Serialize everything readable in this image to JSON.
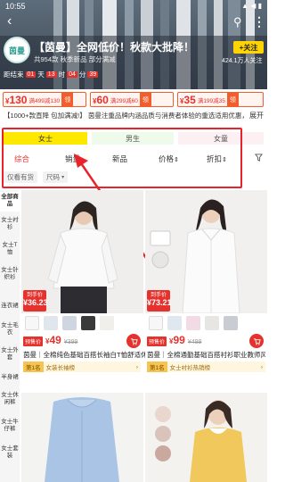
{
  "status": {
    "time": "10:55",
    "sys": "▲ ◀ ▮"
  },
  "nav": {
    "back": "‹",
    "search": "⚲",
    "more": "⋮"
  },
  "shop": {
    "logo": "茵曼",
    "name": "【茵曼】全网低价！秋款大批降！",
    "sub": "共954款  秋季新品  部分满减",
    "follow": "+关注",
    "fans": "424.1万人关注"
  },
  "countdown": {
    "label": "距结束",
    "days": "01",
    "d_unit": "天",
    "hours": "13",
    "h_unit": "时",
    "minutes": "04",
    "m_unit": "分",
    "seconds": "39"
  },
  "coupons": [
    {
      "amount": "130",
      "cond": "满499减130",
      "get": "领"
    },
    {
      "amount": "60",
      "cond": "满299减60",
      "get": "领"
    },
    {
      "amount": "35",
      "cond": "满199减35",
      "get": "领"
    }
  ],
  "notice": {
    "text": "【1000+款直降 包加满减!】 茵曼注重品牌内涵品质与消费者体验的重选适用优惠，钱…",
    "expand": "展开"
  },
  "categories": [
    "女士",
    "男生",
    "女童"
  ],
  "sort": {
    "items": [
      "综合",
      "销量",
      "新品",
      "价格",
      "折扣"
    ],
    "price_arrow": "⇕",
    "discount_arrow": "⇕"
  },
  "filters": {
    "stock": "仅看有货",
    "size": "尺码"
  },
  "sidebar": [
    "全部商品",
    "女士衬衫",
    "女士T恤",
    "女士针织衫",
    "连衣裙",
    "女士毛衣",
    "女士外套",
    "半身裙",
    "女士休闲裤",
    "女士牛仔裤",
    "女士套装"
  ],
  "products": [
    {
      "tag_label": "到手价",
      "tag_price": "¥36.23",
      "badge": "预售价",
      "price": "49",
      "old": "¥399",
      "title": "茵曼｜全棉纯色基础百搭长袖白T恤舒适休闲",
      "rank_no": "第1名",
      "rank_txt": "女装长袖榜",
      "rank_arrow": "›"
    },
    {
      "tag_label": "到手价",
      "tag_price": "¥73.21",
      "badge": "预售价",
      "price": "99",
      "old": "¥499",
      "title": "茵曼｜全棉通勤基础百搭衬衫职业教师风",
      "rank_no": "第1名",
      "rank_txt": "女士衬衫热销榜",
      "rank_arrow": "›"
    }
  ],
  "colors": {
    "accent": "#e5322d",
    "highlight": "#ffe800",
    "annotation": "#e8232a"
  }
}
